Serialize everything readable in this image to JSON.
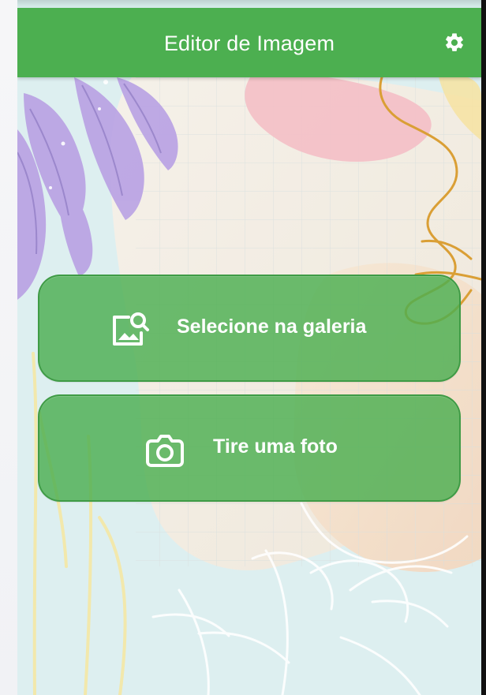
{
  "app": {
    "title": "Editor de Imagem"
  },
  "actions": {
    "gallery_label": "Selecione na galeria",
    "camera_label": "Tire uma foto"
  },
  "icons": {
    "settings": "settings-icon",
    "gallery": "image-search-icon",
    "camera": "camera-icon"
  },
  "colors": {
    "app_bar": "#4caf50",
    "button_fill": "#4caf50",
    "button_text": "#ffffff",
    "background_teal": "#d9efee",
    "pink_shape": "#f2bfc6",
    "purple_leaf": "#b8a1e3"
  }
}
